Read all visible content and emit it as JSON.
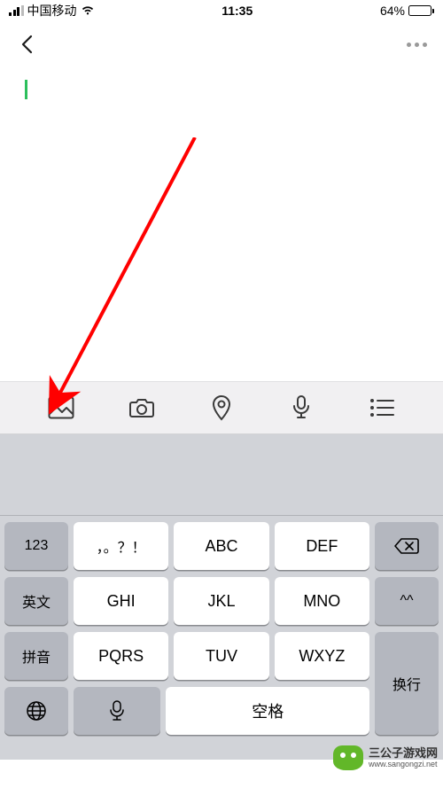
{
  "status": {
    "carrier": "中国移动",
    "time": "11:35",
    "battery_pct": "64%"
  },
  "editor": {
    "content": ""
  },
  "toolbar": {
    "image": "image-icon",
    "camera": "camera-icon",
    "location": "location-icon",
    "voice": "voice-icon",
    "list": "list-icon"
  },
  "keyboard": {
    "row1": {
      "k1": "123",
      "k2": "，。？！",
      "k3": "ABC",
      "k4": "DEF",
      "backspace": "⌫"
    },
    "row2": {
      "k1": "英文",
      "k2": "GHI",
      "k3": "JKL",
      "k4": "MNO",
      "emoji": "^^"
    },
    "row3": {
      "k1": "拼音",
      "k2": "PQRS",
      "k3": "TUV",
      "k4": "WXYZ"
    },
    "row4": {
      "space": "空格",
      "enter": "换行"
    }
  },
  "watermark": {
    "title": "三公子游戏网",
    "url": "www.sangongzi.net"
  },
  "annotation": {
    "arrow_target": "gallery-button"
  }
}
